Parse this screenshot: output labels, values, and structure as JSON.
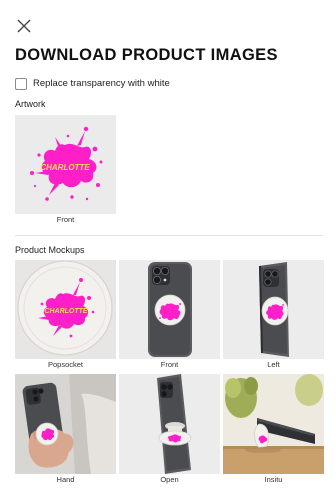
{
  "dialog": {
    "close_icon": "close-icon",
    "title": "DOWNLOAD PRODUCT IMAGES"
  },
  "options": {
    "replace_transparency_label": "Replace transparency with white",
    "replace_transparency_checked": false
  },
  "artwork": {
    "section_label": "Artwork",
    "items": [
      {
        "caption": "Front",
        "artwork_text": "CHARLOTTE"
      }
    ]
  },
  "mockups": {
    "section_label": "Product Mockups",
    "items": [
      {
        "caption": "Popsocket"
      },
      {
        "caption": "Front"
      },
      {
        "caption": "Left"
      },
      {
        "caption": "Hand"
      },
      {
        "caption": "Open"
      },
      {
        "caption": "Insitu"
      }
    ]
  },
  "colors": {
    "accent_pink": "#ff1fc8",
    "artwork_text_yellow": "#f2e24a",
    "thumb_bg": "#ececec",
    "phone_dark": "#4a4c50"
  }
}
